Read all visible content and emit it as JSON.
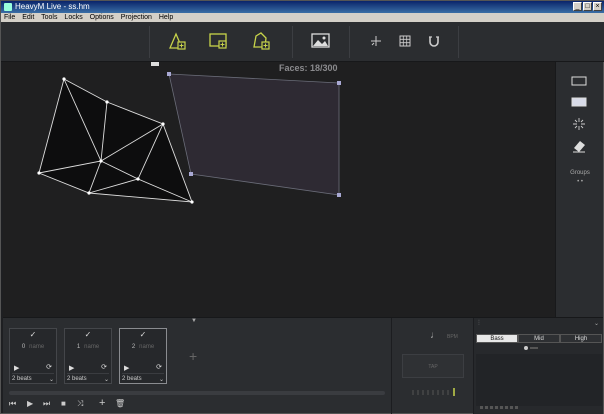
{
  "window": {
    "title": "HeavyM Live - ss.hm",
    "controls": [
      "_",
      "□",
      "×"
    ]
  },
  "menu": {
    "items": [
      "File",
      "Edit",
      "Tools",
      "Locks",
      "Options",
      "Projection",
      "Help"
    ]
  },
  "toolbar": {
    "icons": [
      "add-shape-icon",
      "add-layer-icon",
      "add-group-icon",
      "image-icon",
      "crosshair-icon",
      "grid-icon",
      "magnet-icon"
    ]
  },
  "canvas": {
    "faces_label": "Faces: 18/300"
  },
  "right_panel": {
    "groups_label": "Groups",
    "groups_dots": "•   •"
  },
  "sequences": [
    {
      "number": "0",
      "name": "name",
      "beats": "2 beats",
      "active": false
    },
    {
      "number": "1",
      "name": "name",
      "beats": "2 beats",
      "active": false
    },
    {
      "number": "2",
      "name": "name",
      "beats": "2 beats",
      "active": true
    }
  ],
  "transport": {
    "icons": [
      "skip-back-icon",
      "play-icon",
      "skip-forward-icon",
      "stop-icon",
      "shuffle-icon",
      "add-icon",
      "trash-icon"
    ]
  },
  "audio": {
    "bpm_label": "BPM",
    "tap_label": "TAP"
  },
  "freq": {
    "tabs": [
      "Bass",
      "Mid",
      "High"
    ],
    "selected": "Bass"
  },
  "colors": {
    "accent": "#c8d44a",
    "background": "#1f1f20",
    "panel": "#2b2d30"
  }
}
